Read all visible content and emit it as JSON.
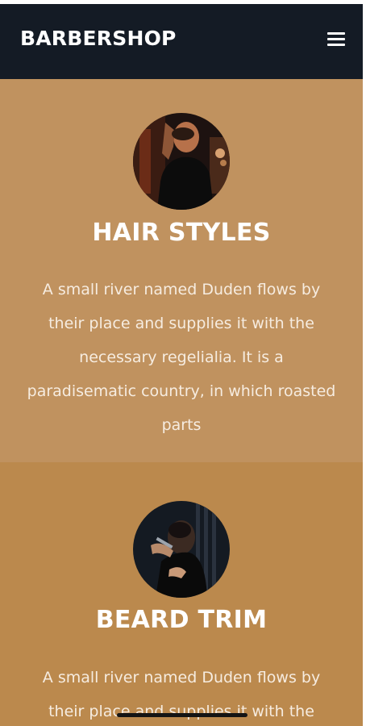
{
  "navbar": {
    "brand": "BARBERSHOP",
    "menu_icon": "hamburger-menu-icon"
  },
  "services": [
    {
      "title": "HAIR STYLES",
      "description": "A small river named Duden flows by their place and supplies it with the necessary regelialia. It is a paradisematic country, in which roasted parts",
      "image": "barber-portrait-photo",
      "background": "#c0925f"
    },
    {
      "title": "BEARD TRIM",
      "description": "A small river named Duden flows by their place and supplies it with the",
      "image": "barber-cutting-hair-photo",
      "background": "#bb894d"
    }
  ],
  "colors": {
    "navbar": "#141b25",
    "text": "#ffffff"
  }
}
